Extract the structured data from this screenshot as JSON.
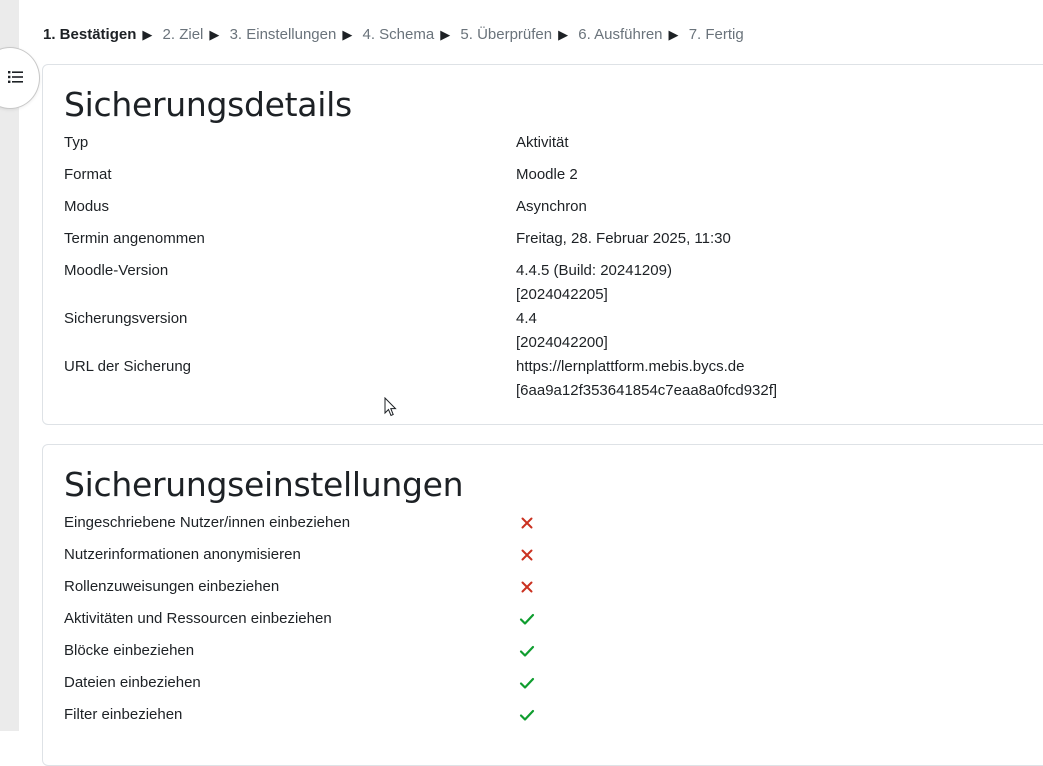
{
  "steps": [
    {
      "label": "1. Bestätigen",
      "active": true
    },
    {
      "label": "2. Ziel"
    },
    {
      "label": "3. Einstellungen"
    },
    {
      "label": "4. Schema"
    },
    {
      "label": "5. Überprüfen"
    },
    {
      "label": "6. Ausführen"
    },
    {
      "label": "7. Fertig"
    }
  ],
  "step_separator": "▶",
  "details": {
    "title": "Sicherungsdetails",
    "rows": [
      {
        "label": "Typ",
        "value": "Aktivität"
      },
      {
        "label": "Format",
        "value": "Moodle 2"
      },
      {
        "label": "Modus",
        "value": "Asynchron"
      },
      {
        "label": "Termin angenommen",
        "value": "Freitag, 28. Februar 2025, 11:30"
      },
      {
        "label": "Moodle-Version",
        "value": "4.4.5 (Build: 20241209)",
        "value2": "[2024042205]"
      },
      {
        "label": "Sicherungsversion",
        "value": "4.4",
        "value2": "[2024042200]"
      },
      {
        "label": "URL der Sicherung",
        "value": "https://lernplattform.mebis.bycs.de",
        "value2": "[6aa9a12f353641854c7eaa8a0fcd932f]"
      }
    ]
  },
  "settings": {
    "title": "Sicherungseinstellungen",
    "rows": [
      {
        "label": "Eingeschriebene Nutzer/innen einbeziehen",
        "enabled": false,
        "icon": "cross-icon"
      },
      {
        "label": "Nutzerinformationen anonymisieren",
        "enabled": false,
        "icon": "cross-icon"
      },
      {
        "label": "Rollenzuweisungen einbeziehen",
        "enabled": false,
        "icon": "cross-icon"
      },
      {
        "label": "Aktivitäten und Ressourcen einbeziehen",
        "enabled": true,
        "icon": "check-icon"
      },
      {
        "label": "Blöcke einbeziehen",
        "enabled": true,
        "icon": "check-icon"
      },
      {
        "label": "Dateien einbeziehen",
        "enabled": true,
        "icon": "check-icon"
      },
      {
        "label": "Filter einbeziehen",
        "enabled": true,
        "icon": "check-icon"
      }
    ]
  },
  "colors": {
    "cross": "#ca3120",
    "check": "#0f9d2f"
  },
  "icons": {
    "drawer_toggle": "list-icon"
  }
}
